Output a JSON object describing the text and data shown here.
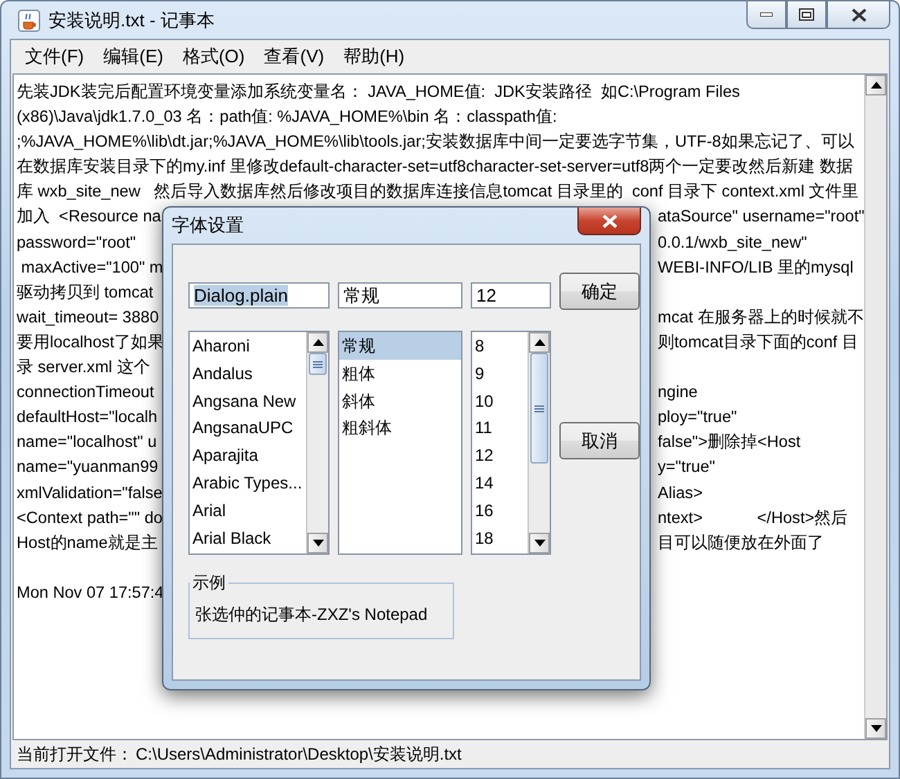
{
  "window": {
    "title": "安装说明.txt - 记事本"
  },
  "menu": [
    "文件(F)",
    "编辑(E)",
    "格式(O)",
    "查看(V)",
    "帮助(H)"
  ],
  "editor": {
    "lines": [
      {
        "left": "先装JDK装完后配置环境变量添加系统变量名： JAVA_HOME值:  JDK安装路径  如C:\\Program Files"
      },
      {
        "left": "(x86)\\Java\\jdk1.7.0_03 名：path值: %JAVA_HOME%\\bin 名：classpath值:"
      },
      {
        "left": ";%JAVA_HOME%\\lib\\dt.jar;%JAVA_HOME%\\lib\\tools.jar;安装数据库中间一定要选字节集，UTF-8如果忘记了、可以"
      },
      {
        "left": "在数据库安装目录下的my.inf 里修改default-character-set=utf8character-set-server=utf8两个一定要改然后新建 数据"
      },
      {
        "left": "库 wxb_site_new   然后导入数据库然后修改项目的数据库连接信息tomcat 目录里的  conf 目录下 context.xml 文件里"
      },
      {
        "left": "加入  <Resource na",
        "right": "ataSource\" username=\"root\""
      },
      {
        "left": "password=\"root\"",
        "right": "0.0.1/wxb_site_new\""
      },
      {
        "left": " maxActive=\"100\" m",
        "right": "WEBI-INFO/LIB 里的mysql"
      },
      {
        "left": "驱动拷贝到 tomcat"
      },
      {
        "left": "wait_timeout= 3880",
        "right": "mcat 在服务器上的时候就不"
      },
      {
        "left": "要用localhost了如果",
        "right": "则tomcat目录下面的conf 目"
      },
      {
        "left": "录 server.xml 这个"
      },
      {
        "left": "connectionTimeout",
        "right": "ngine"
      },
      {
        "left": "defaultHost=\"localh",
        "right": "ploy=\"true\""
      },
      {
        "left": "name=\"localhost\" u",
        "right": "false\">删除掉<Host"
      },
      {
        "left": "name=\"yuanman99",
        "right": "y=\"true\""
      },
      {
        "left": "xmlValidation=\"false",
        "right": "Alias>"
      },
      {
        "left": "<Context path=\"\" do",
        "right": "ntext>            </Host>然后"
      },
      {
        "left": "Host的name就是主",
        "right": "目可以随便放在外面了"
      },
      {
        "left": "Mon Nov 07 17:57:4",
        "blank_before": true
      }
    ]
  },
  "status_bar": {
    "label": "当前打开文件：",
    "path": "C:\\Users\\Administrator\\Desktop\\安装说明.txt"
  },
  "dialog": {
    "title": "字体设置",
    "font_field": {
      "value": "Dialog.plain",
      "text_selected": true
    },
    "style_field": {
      "value": "常规"
    },
    "size_field": {
      "value": "12"
    },
    "ok_button": "确定",
    "cancel_button": "取消",
    "font_list": [
      {
        "label": "Aharoni",
        "selected": false
      },
      {
        "label": "Andalus",
        "selected": false
      },
      {
        "label": "Angsana New",
        "selected": false
      },
      {
        "label": "AngsanaUPC",
        "selected": false
      },
      {
        "label": "Aparajita",
        "selected": false
      },
      {
        "label": "Arabic Types...",
        "selected": false
      },
      {
        "label": "Arial",
        "selected": false
      },
      {
        "label": "Arial Black",
        "selected": false
      }
    ],
    "style_list": [
      {
        "label": "常规",
        "selected": true
      },
      {
        "label": "粗体",
        "selected": false
      },
      {
        "label": "斜体",
        "selected": false
      },
      {
        "label": "粗斜体",
        "selected": false
      }
    ],
    "size_list": [
      {
        "label": "8",
        "selected": false
      },
      {
        "label": "9",
        "selected": false
      },
      {
        "label": "10",
        "selected": false
      },
      {
        "label": "11",
        "selected": false
      },
      {
        "label": "12",
        "selected": false
      },
      {
        "label": "14",
        "selected": false
      },
      {
        "label": "16",
        "selected": false
      },
      {
        "label": "18",
        "selected": false
      }
    ],
    "sample": {
      "legend": "示例",
      "text": "张选仲的记事本-ZXZ's Notepad"
    }
  }
}
